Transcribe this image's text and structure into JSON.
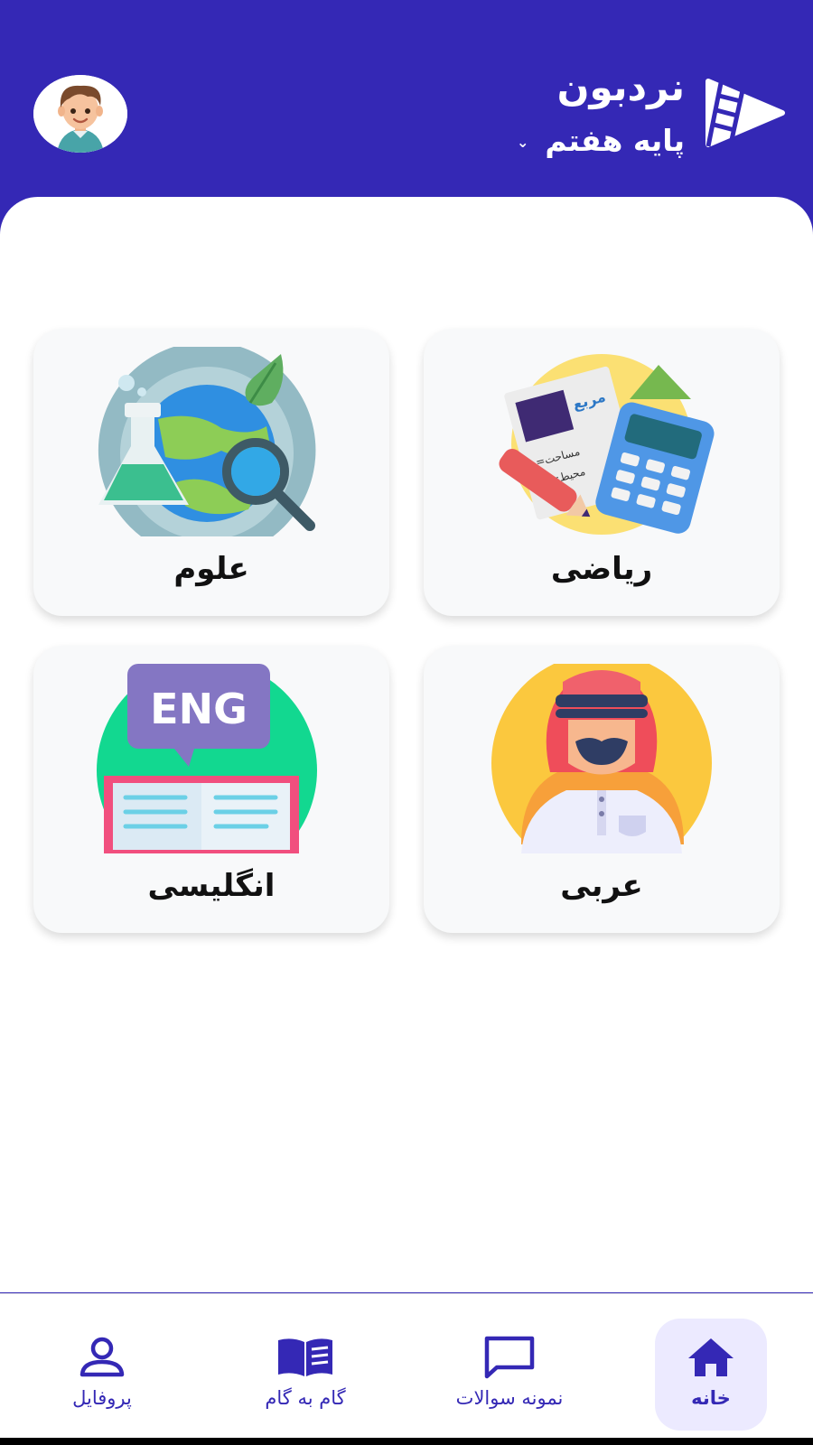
{
  "header": {
    "app_title": "نردبون",
    "grade_label": "پایه هفتم",
    "grade_dropdown_icon": "chevron-down-icon",
    "logo_icon": "ladder-play-logo-icon",
    "avatar": "boy-avatar",
    "background_color": "#3428b5"
  },
  "subjects": [
    {
      "label": "ریاضی",
      "icon": "math-illustration",
      "illustration_text": [
        "مربع",
        "=مساحت",
        "=محیط"
      ]
    },
    {
      "label": "علوم",
      "icon": "science-illustration"
    },
    {
      "label": "عربی",
      "icon": "arabic-illustration"
    },
    {
      "label": "انگلیسی",
      "icon": "english-illustration",
      "illustration_text": [
        "ENG"
      ]
    }
  ],
  "bottom_nav": {
    "active": "home",
    "accent_color": "#3428b5",
    "items": [
      {
        "label": "خانه",
        "icon": "home-icon"
      },
      {
        "label": "نمونه سوالات",
        "icon": "chat-icon"
      },
      {
        "label": "گام به گام",
        "icon": "book-icon"
      },
      {
        "label": "پروفایل",
        "icon": "user-icon"
      }
    ]
  }
}
